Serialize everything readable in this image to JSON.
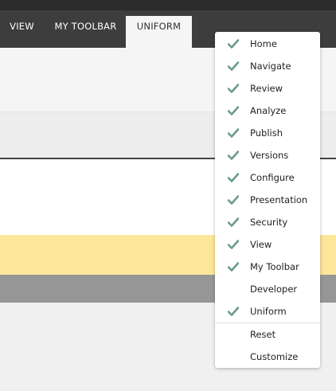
{
  "tabs": [
    {
      "label": "VIEW",
      "active": false
    },
    {
      "label": "MY TOOLBAR",
      "active": false
    },
    {
      "label": "UNIFORM",
      "active": true
    }
  ],
  "menu": {
    "items": [
      {
        "label": "Home",
        "checked": true
      },
      {
        "label": "Navigate",
        "checked": true
      },
      {
        "label": "Review",
        "checked": true
      },
      {
        "label": "Analyze",
        "checked": true
      },
      {
        "label": "Publish",
        "checked": true
      },
      {
        "label": "Versions",
        "checked": true
      },
      {
        "label": "Configure",
        "checked": true
      },
      {
        "label": "Presentation",
        "checked": true
      },
      {
        "label": "Security",
        "checked": true
      },
      {
        "label": "View",
        "checked": true
      },
      {
        "label": "My Toolbar",
        "checked": true
      },
      {
        "label": "Developer",
        "checked": false
      },
      {
        "label": "Uniform",
        "checked": true
      }
    ],
    "actions": [
      {
        "label": "Reset"
      },
      {
        "label": "Customize"
      }
    ]
  },
  "colors": {
    "check": "#6b9b87",
    "highlight_bar": "#fbe69a",
    "tabbar": "#3d3d3d"
  },
  "icons": {
    "checked_item": "checkmark-icon"
  }
}
